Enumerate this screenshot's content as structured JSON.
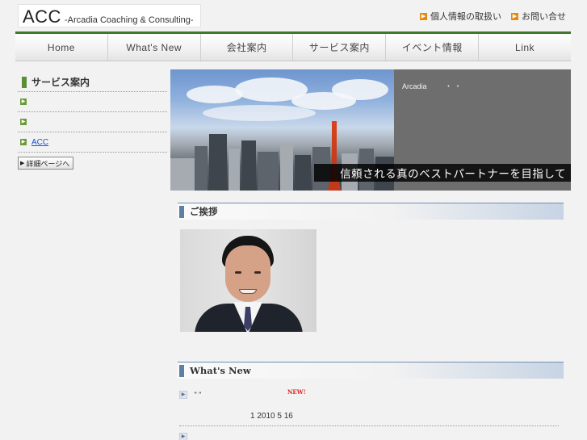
{
  "header": {
    "logo_main": "ACC",
    "logo_sub": "-Arcadia Coaching & Consulting-",
    "util_links": [
      "個人情報の取扱い",
      "お問い合せ"
    ]
  },
  "nav": [
    "Home",
    "What's New",
    "会社案内",
    "サービス案内",
    "イベント情報",
    "Link"
  ],
  "sidebar": {
    "title": "サービス案内",
    "items": [
      "",
      "",
      "ACC"
    ],
    "detail_button": "詳細ページへ"
  },
  "hero": {
    "company": "Arcadia",
    "side_marks": "・ ・",
    "slogan": "信頼される真のベストパートナーを目指して"
  },
  "greeting": {
    "title": "ご挨拶"
  },
  "whats_new": {
    "title": "What's New",
    "items": [
      {
        "text": "\"           \"",
        "badge": "NEW!",
        "date": "1  2010 5 16"
      }
    ]
  },
  "colors": {
    "nav_accent": "#3f7a2a",
    "link": "#1a4fd6",
    "section_bar": "#5d7fa8",
    "utility_icon": "#e58a10"
  }
}
